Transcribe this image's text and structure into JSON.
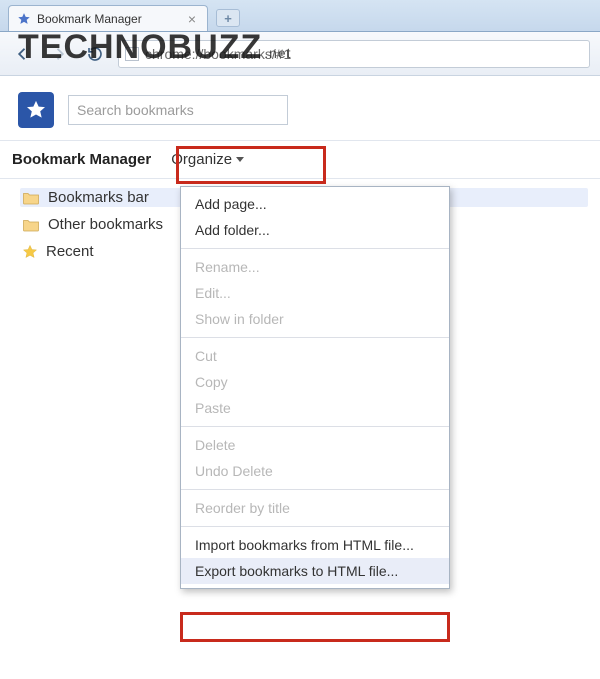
{
  "tab": {
    "title": "Bookmark Manager"
  },
  "omnibox": {
    "url": "chrome://bookmarks/#1"
  },
  "watermark": {
    "brand": "TECHNOBUZZ",
    "tld": ".net"
  },
  "search": {
    "placeholder": "Search bookmarks"
  },
  "header": {
    "title": "Bookmark Manager",
    "organize": "Organize"
  },
  "sidebar": {
    "items": [
      {
        "label": "Bookmarks bar",
        "icon": "folder",
        "selected": true
      },
      {
        "label": "Other bookmarks",
        "icon": "folder",
        "selected": false
      },
      {
        "label": "Recent",
        "icon": "star",
        "selected": false
      }
    ]
  },
  "menu": {
    "items": [
      {
        "label": "Add page...",
        "enabled": true
      },
      {
        "label": "Add folder...",
        "enabled": true
      },
      {
        "sep": true
      },
      {
        "label": "Rename...",
        "enabled": false
      },
      {
        "label": "Edit...",
        "enabled": false
      },
      {
        "label": "Show in folder",
        "enabled": false
      },
      {
        "sep": true
      },
      {
        "label": "Cut",
        "enabled": false
      },
      {
        "label": "Copy",
        "enabled": false
      },
      {
        "label": "Paste",
        "enabled": false
      },
      {
        "sep": true
      },
      {
        "label": "Delete",
        "enabled": false
      },
      {
        "label": "Undo Delete",
        "enabled": false
      },
      {
        "sep": true
      },
      {
        "label": "Reorder by title",
        "enabled": false
      },
      {
        "sep": true
      },
      {
        "label": "Import bookmarks from HTML file...",
        "enabled": true
      },
      {
        "label": "Export bookmarks to HTML file...",
        "enabled": true,
        "highlight": true
      }
    ]
  }
}
